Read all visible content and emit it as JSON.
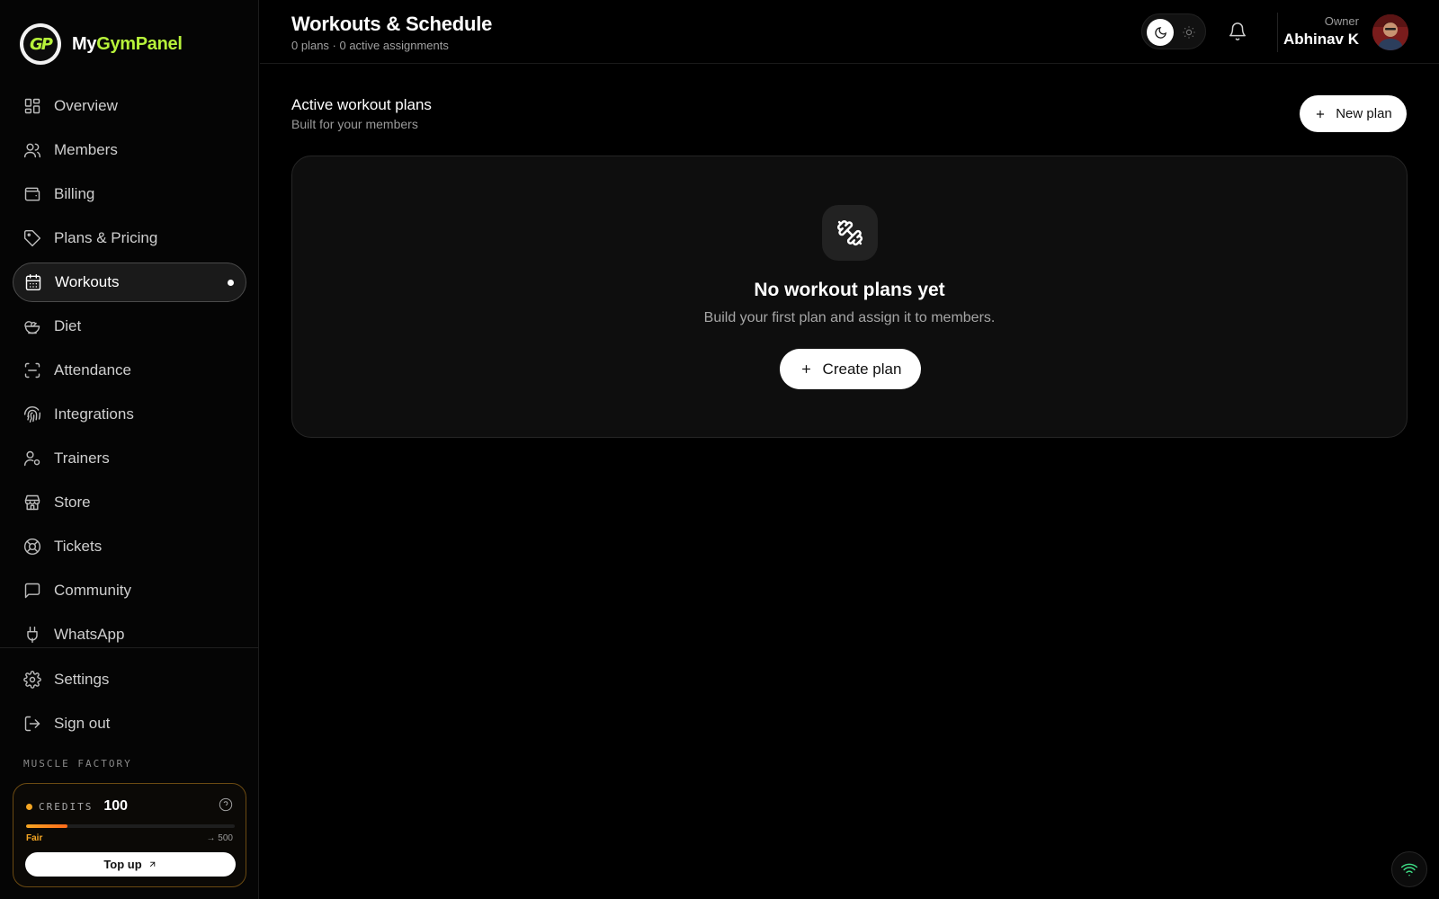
{
  "brand": {
    "name_prefix": "My",
    "name_accent": "GymPanel",
    "logo_text": "GP",
    "accent_color": "#b7f23a"
  },
  "sidebar": {
    "items": [
      {
        "label": "Overview",
        "icon": "grid-icon"
      },
      {
        "label": "Members",
        "icon": "users-icon"
      },
      {
        "label": "Billing",
        "icon": "wallet-icon"
      },
      {
        "label": "Plans & Pricing",
        "icon": "tag-icon"
      },
      {
        "label": "Workouts",
        "icon": "calendar-icon",
        "active": true
      },
      {
        "label": "Diet",
        "icon": "salad-icon"
      },
      {
        "label": "Attendance",
        "icon": "scan-icon"
      },
      {
        "label": "Integrations",
        "icon": "fingerprint-icon"
      },
      {
        "label": "Trainers",
        "icon": "user-cog-icon"
      },
      {
        "label": "Store",
        "icon": "store-icon"
      },
      {
        "label": "Tickets",
        "icon": "lifebuoy-icon"
      },
      {
        "label": "Community",
        "icon": "message-icon"
      },
      {
        "label": "WhatsApp",
        "icon": "plug-icon"
      }
    ],
    "bottom_items": [
      {
        "label": "Settings",
        "icon": "gear-icon"
      },
      {
        "label": "Sign out",
        "icon": "logout-icon"
      }
    ],
    "gym_name": "MUSCLE FACTORY",
    "credits": {
      "label": "CREDITS",
      "value": "100",
      "status": "Fair",
      "target": "→ 500",
      "progress": 0.2,
      "topup_label": "Top up",
      "status_color": "#f5a623"
    }
  },
  "header": {
    "title": "Workouts & Schedule",
    "subtitle": "0 plans · 0 active assignments",
    "user_role": "Owner",
    "user_name": "Abhinav K"
  },
  "main": {
    "section_title": "Active workout plans",
    "section_subtitle": "Built for your members",
    "new_plan_label": "New plan",
    "empty": {
      "title": "No workout plans yet",
      "description": "Build your first plan and assign it to members.",
      "button_label": "Create plan",
      "icon": "dumbbell-icon"
    }
  }
}
